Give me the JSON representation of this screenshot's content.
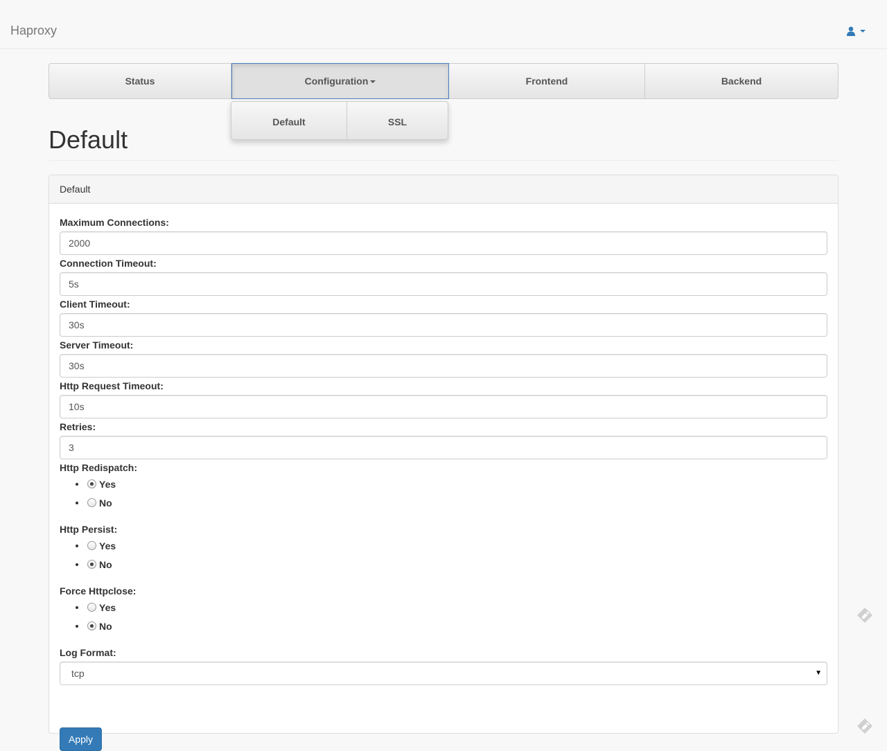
{
  "navbar": {
    "brand": "Haproxy",
    "user_icon": "user-icon",
    "user_caret_icon": "caret-down-icon",
    "accent_color": "#337ab7"
  },
  "tabs": [
    {
      "label": "Status"
    },
    {
      "label": "Configuration",
      "active": true,
      "dropdown": true
    },
    {
      "label": "Frontend"
    },
    {
      "label": "Backend"
    }
  ],
  "submenu": [
    {
      "label": "Default"
    },
    {
      "label": "SSL"
    }
  ],
  "page": {
    "title": "Default"
  },
  "panel": {
    "heading": "Default",
    "fields": [
      {
        "label": "Maximum Connections:",
        "value": "2000"
      },
      {
        "label": "Connection Timeout:",
        "value": "5s"
      },
      {
        "label": "Client Timeout:",
        "value": "30s"
      },
      {
        "label": "Server Timeout:",
        "value": "30s"
      },
      {
        "label": "Http Request Timeout:",
        "value": "10s"
      },
      {
        "label": "Retries:",
        "value": "3"
      }
    ],
    "radios": [
      {
        "label": "Http Redispatch:",
        "options": [
          "Yes",
          "No"
        ],
        "selected": "Yes"
      },
      {
        "label": "Http Persist:",
        "options": [
          "Yes",
          "No"
        ],
        "selected": "No"
      },
      {
        "label": "Force Httpclose:",
        "options": [
          "Yes",
          "No"
        ],
        "selected": "No"
      }
    ],
    "log_format": {
      "label": "Log Format:",
      "value": "tcp"
    },
    "apply_label": "Apply",
    "apply_color": "#337ab7"
  },
  "floating_icons": [
    "feedback-icon",
    "feedback-icon"
  ]
}
